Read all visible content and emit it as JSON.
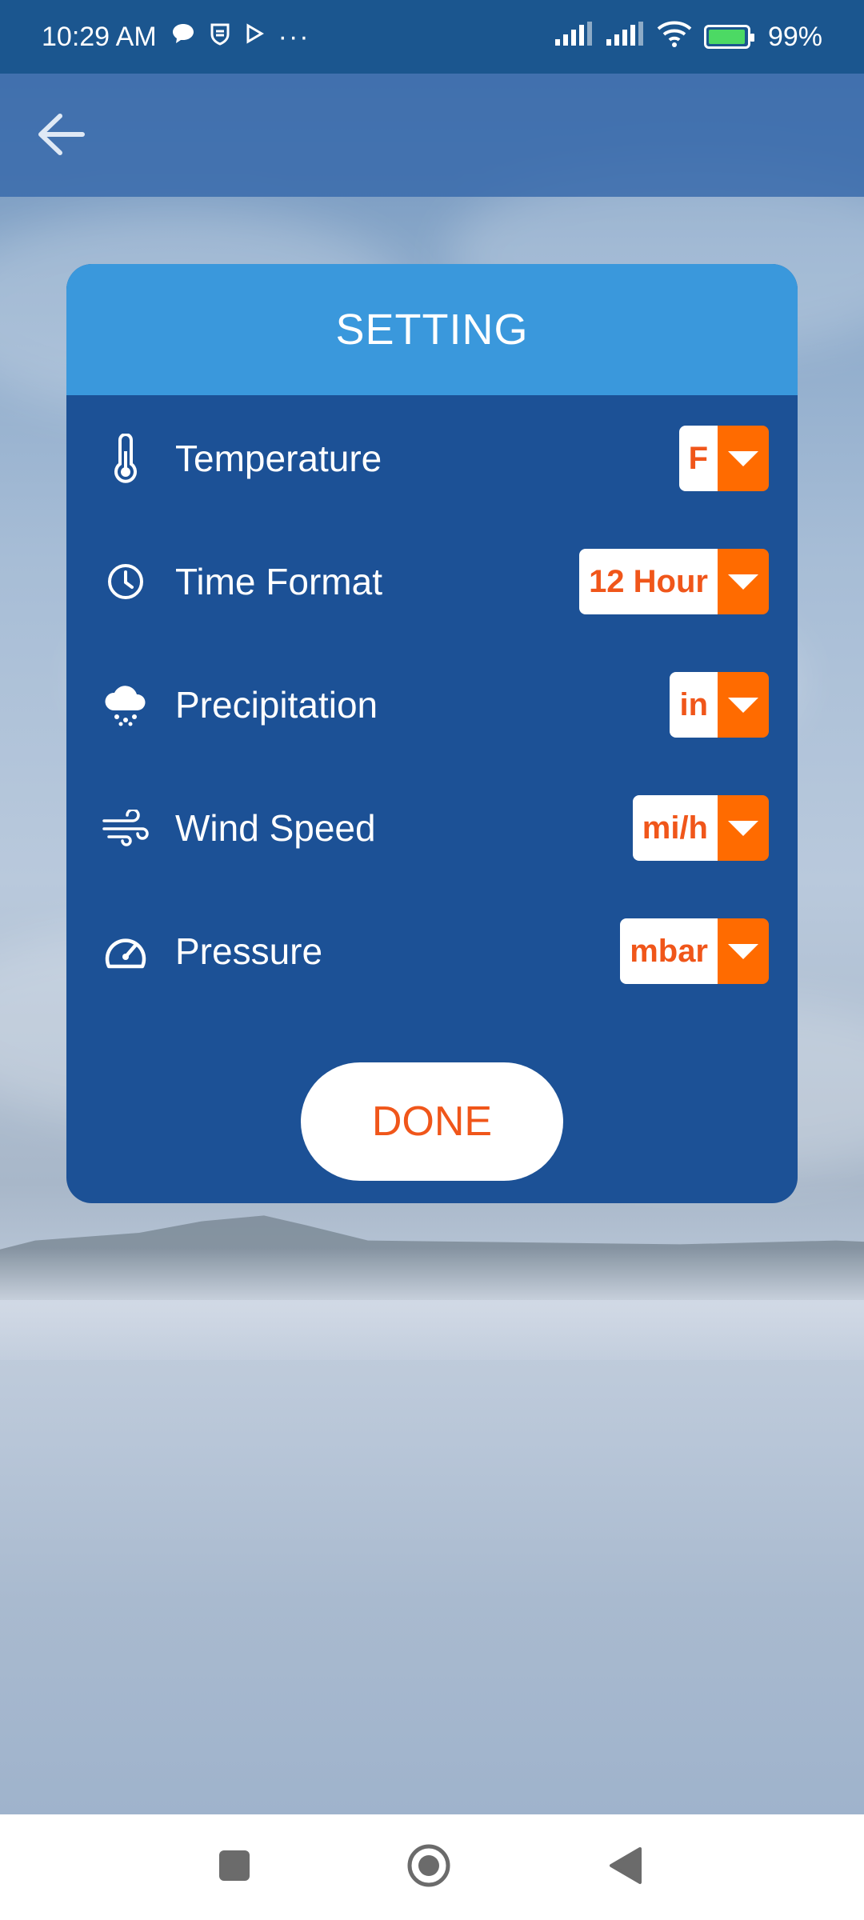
{
  "status_bar": {
    "time": "10:29 AM",
    "icons_left": [
      "chat-bubble-icon",
      "shield-icon",
      "play-icon",
      "more-dots-icon"
    ],
    "more": "···",
    "battery": "99%",
    "battery_fraction": 0.99
  },
  "app_bar": {
    "back_icon": "arrow-left-icon"
  },
  "dialog": {
    "title": "SETTING",
    "rows": [
      {
        "label": "Temperature",
        "icon": "thermometer-icon",
        "value": "F"
      },
      {
        "label": "Time Format",
        "icon": "clock-icon",
        "value": "12 Hour"
      },
      {
        "label": "Precipitation",
        "icon": "rain-cloud-icon",
        "value": "in"
      },
      {
        "label": "Wind Speed",
        "icon": "wind-icon",
        "value": "mi/h"
      },
      {
        "label": "Pressure",
        "icon": "gauge-icon",
        "value": "mbar"
      }
    ],
    "done_label": "DONE"
  },
  "nav_bar": {
    "buttons": [
      "recents-square-icon",
      "home-circle-icon",
      "back-triangle-icon"
    ]
  },
  "colors": {
    "status_bar": "#1b568f",
    "dialog_body": "#1c5196",
    "dialog_header": "#3a98dc",
    "accent_orange": "#ff6b00",
    "value_text": "#f0561a"
  }
}
